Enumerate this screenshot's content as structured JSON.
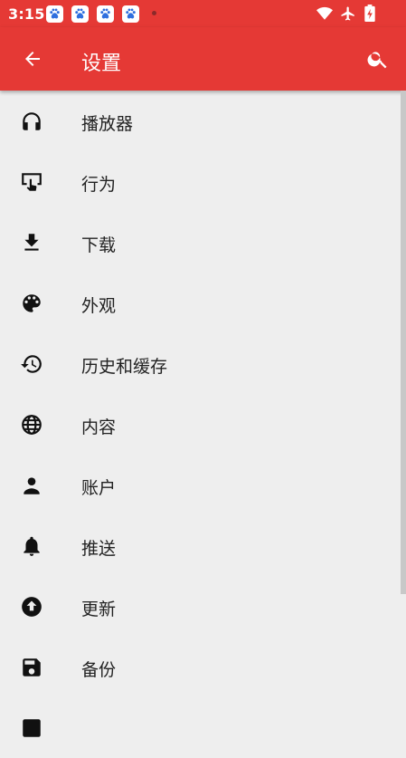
{
  "status": {
    "time": "3:15",
    "icons": [
      "baidu-icon",
      "baidu-icon",
      "baidu-icon",
      "baidu-icon",
      "dot-icon",
      "wifi-icon",
      "airplane-icon",
      "battery-icon"
    ]
  },
  "appbar": {
    "title": "设置",
    "back_icon": "arrow-left-icon",
    "search_icon": "search-icon"
  },
  "settings": {
    "items": [
      {
        "label": "播放器",
        "icon": "headphones-icon"
      },
      {
        "label": "行为",
        "icon": "touch-screen-icon"
      },
      {
        "label": "下载",
        "icon": "download-icon"
      },
      {
        "label": "外观",
        "icon": "palette-icon"
      },
      {
        "label": "历史和缓存",
        "icon": "history-icon"
      },
      {
        "label": "内容",
        "icon": "globe-icon"
      },
      {
        "label": "账户",
        "icon": "person-icon"
      },
      {
        "label": "推送",
        "icon": "bell-icon"
      },
      {
        "label": "更新",
        "icon": "upload-circle-icon"
      },
      {
        "label": "备份",
        "icon": "save-icon"
      }
    ]
  },
  "colors": {
    "primary": "#e53935",
    "background": "#eeeeee",
    "text": "#222222"
  }
}
